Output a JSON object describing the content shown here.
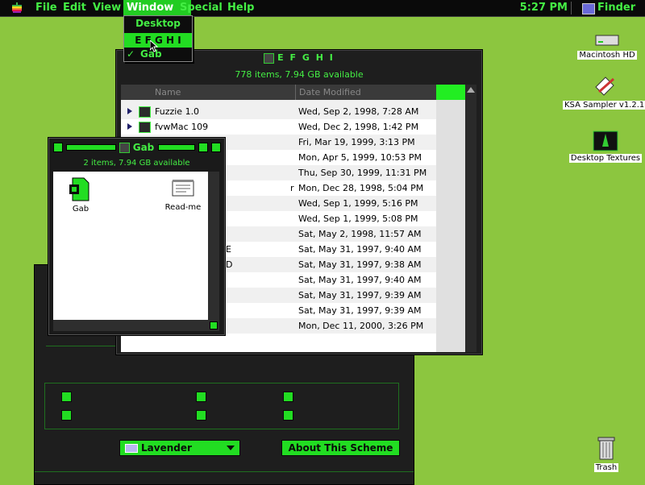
{
  "menubar": {
    "items": [
      "File",
      "Edit",
      "View",
      "Window",
      "Special",
      "Help"
    ],
    "active": "Window",
    "clock": "5:27 PM",
    "app": "Finder"
  },
  "window_menu": {
    "items": [
      {
        "label": "Desktop",
        "checked": false,
        "highlighted": false
      },
      {
        "label": "E F G H I",
        "checked": false,
        "highlighted": true
      },
      {
        "label": "Gab",
        "checked": true,
        "highlighted": false
      }
    ],
    "check_mark": "✓"
  },
  "desktop_icons": [
    {
      "label": "Macintosh HD",
      "icon": "hard-disk-icon"
    },
    {
      "label": "KSA Sampler v1.2.1",
      "icon": "document-pen-icon"
    },
    {
      "label": "Desktop Textures",
      "icon": "app-icon"
    },
    {
      "label": "Trash",
      "icon": "trash-icon"
    }
  ],
  "efghi_window": {
    "title": "E F G H I",
    "status": "778 items, 7.94 GB available",
    "columns": {
      "name": "Name",
      "date": "Date Modified"
    },
    "rows": [
      {
        "name": "Fuzzie 1.0",
        "date": "Wed, Sep 2, 1998, 7:28 AM"
      },
      {
        "name": "fvwMac 109",
        "date": "Wed, Dec 2, 1998, 1:42 PM"
      },
      {
        "name": "",
        "date": "Fri, Mar 19, 1999, 3:13 PM"
      },
      {
        "name": "",
        "date": "Mon, Apr 5, 1999, 10:53 PM"
      },
      {
        "name": "",
        "date": "Thu, Sep 30, 1999, 11:31 PM"
      },
      {
        "name": "r",
        "date": "Mon, Dec 28, 1998, 5:04 PM"
      },
      {
        "name": "",
        "date": "Wed, Sep 1, 1999, 5:16 PM"
      },
      {
        "name": "",
        "date": "Wed, Sep 1, 1999, 5:08 PM"
      },
      {
        "name": "",
        "date": "Sat, May 2, 1998, 11:57 AM"
      },
      {
        "name": "E",
        "date": "Sat, May 31, 1997, 9:40 AM"
      },
      {
        "name": "D",
        "date": "Sat, May 31, 1997, 9:38 AM"
      },
      {
        "name": "",
        "date": "Sat, May 31, 1997, 9:40 AM"
      },
      {
        "name": "",
        "date": "Sat, May 31, 1997, 9:39 AM"
      },
      {
        "name": "",
        "date": "Sat, May 31, 1997, 9:39 AM"
      },
      {
        "name": "",
        "date": "Mon, Dec 11, 2000, 3:26 PM"
      }
    ]
  },
  "gab_window": {
    "title": "Gab",
    "status": "2 items, 7.94 GB available",
    "items": [
      {
        "label": "Gab",
        "icon": "folder-icon"
      },
      {
        "label": "Read-me",
        "icon": "document-icon"
      }
    ]
  },
  "control_panel": {
    "scheme_value": "Lavender",
    "about_label": "About This Scheme"
  },
  "colors": {
    "accent": "#22dd22",
    "desktop": "#8cc63f",
    "chrome": "#1e1e1e"
  }
}
